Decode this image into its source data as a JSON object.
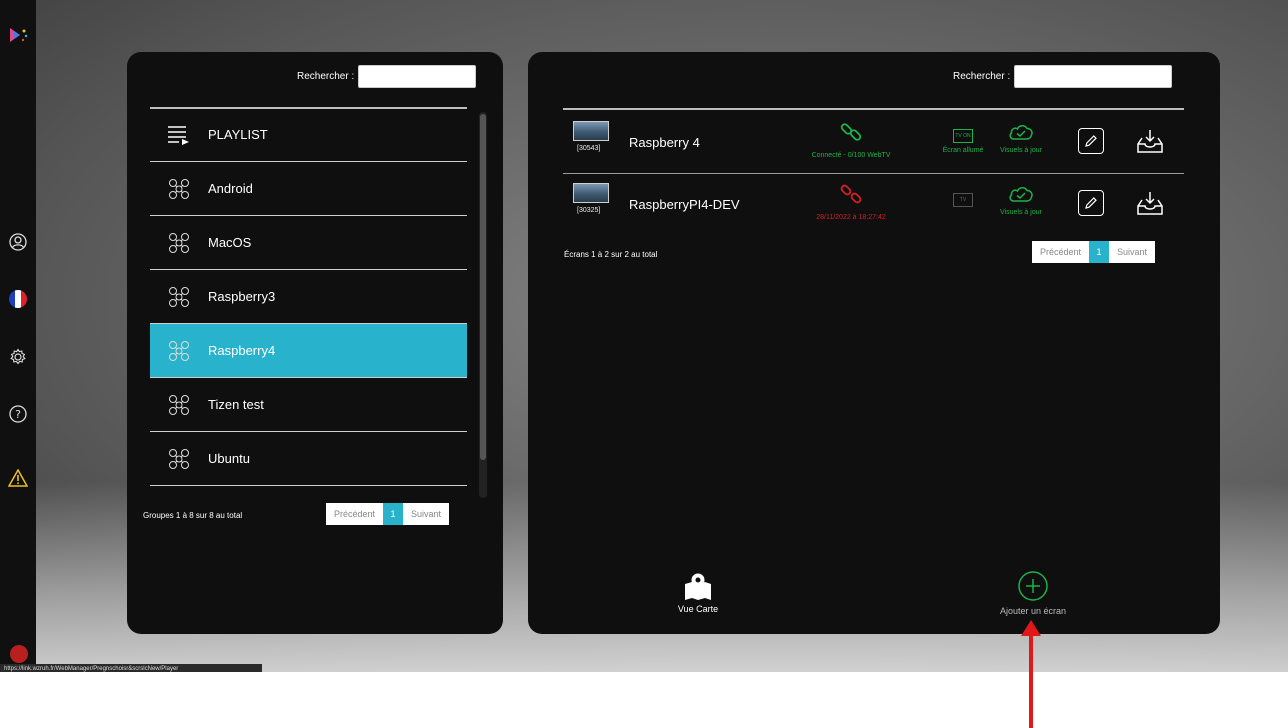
{
  "status_url": "https://link.wzruh.fr/WebManager/Pregnschoisr&scrslcNew/Player",
  "left_panel": {
    "search_label": "Rechercher :",
    "search_value": "",
    "groups": [
      {
        "label": "PLAYLIST",
        "icon": "playlist-icon",
        "active": false
      },
      {
        "label": "Android",
        "icon": "group-icon",
        "active": false
      },
      {
        "label": "MacOS",
        "icon": "group-icon",
        "active": false
      },
      {
        "label": "Raspberry3",
        "icon": "group-icon",
        "active": false
      },
      {
        "label": "Raspberry4",
        "icon": "group-icon",
        "active": true
      },
      {
        "label": "Tizen test",
        "icon": "group-icon",
        "active": false
      },
      {
        "label": "Ubuntu",
        "icon": "group-icon",
        "active": false
      },
      {
        "label": "",
        "icon": "group-icon",
        "active": false
      }
    ],
    "pager_info": "Groupes 1 à 8 sur 8 au total",
    "pager": {
      "prev": "Précédent",
      "page": "1",
      "next": "Suivant"
    }
  },
  "right_panel": {
    "search_label": "Rechercher :",
    "search_value": "",
    "screens": [
      {
        "id": "[30543]",
        "name": "Raspberry 4",
        "conn_text": "Connecté - 0/100 WebTV",
        "conn_status": "connected",
        "tv_label": "TV ON",
        "tv_text": "Écran allumé",
        "tv_on": true,
        "visuals_text": "Visuels à jour"
      },
      {
        "id": "[30325]",
        "name": "RaspberryPI4-DEV",
        "conn_text": "28/11/2022 à 18:27:42",
        "conn_status": "disconnected",
        "tv_label": "TV",
        "tv_text": "",
        "tv_on": false,
        "visuals_text": "Visuels à jour"
      }
    ],
    "pager_info": "Écrans 1 à 2 sur 2 au total",
    "pager": {
      "prev": "Précédent",
      "page": "1",
      "next": "Suivant"
    },
    "map_label": "Vue Carte",
    "add_label": "Ajouter un écran"
  },
  "colors": {
    "accent": "#29b2cc",
    "ok": "#1db34a",
    "error": "#d42020",
    "annotation": "#e01818"
  }
}
